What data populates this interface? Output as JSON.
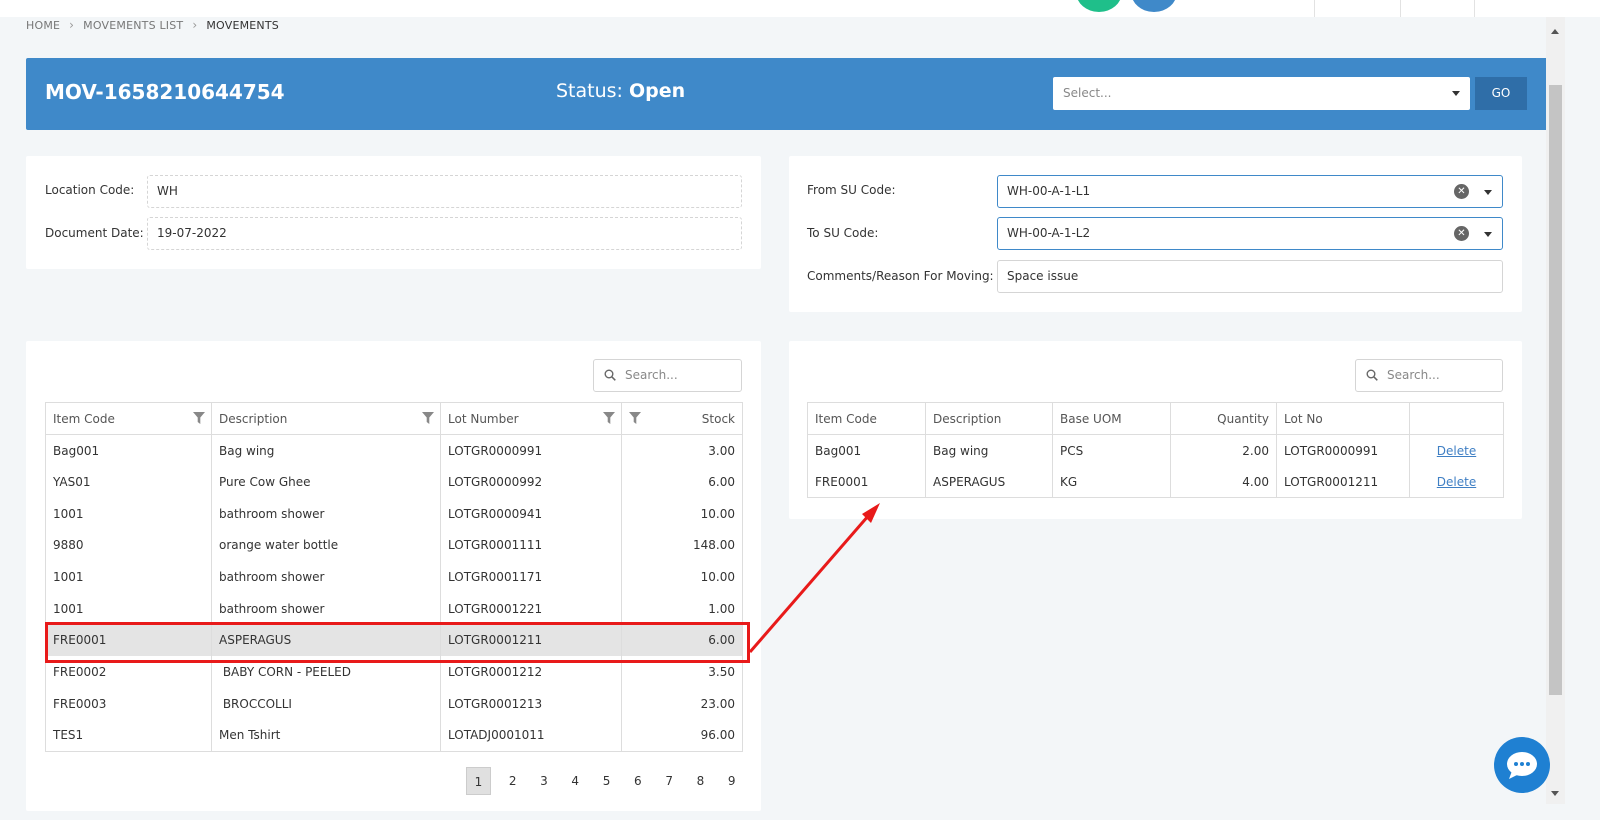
{
  "breadcrumb": {
    "items": [
      "HOME",
      "MOVEMENTS LIST",
      "MOVEMENTS"
    ]
  },
  "header": {
    "doc_no": "MOV-1658210644754",
    "status_label": "Status: ",
    "status_value": "Open",
    "select_placeholder": "Select...",
    "go_label": "GO"
  },
  "left_form": {
    "location_label": "Location Code:",
    "location_value": "WH",
    "date_label": "Document Date:",
    "date_value": "19-07-2022"
  },
  "right_form": {
    "from_label": "From SU Code:",
    "from_value": "WH-00-A-1-L1",
    "to_label": "To SU Code:",
    "to_value": "WH-00-A-1-L2",
    "comments_label": "Comments/Reason For Moving:",
    "comments_value": "Space issue"
  },
  "stock_table": {
    "search_placeholder": "Search...",
    "columns": [
      "Item Code",
      "Description",
      "Lot Number",
      "Stock"
    ],
    "rows": [
      [
        "Bag001",
        "Bag wing",
        "LOTGR0000991",
        "3.00"
      ],
      [
        "YAS01",
        "Pure Cow Ghee",
        "LOTGR0000992",
        "6.00"
      ],
      [
        "1001",
        "bathroom shower",
        "LOTGR0000941",
        "10.00"
      ],
      [
        "9880",
        "orange water bottle",
        "LOTGR0001111",
        "148.00"
      ],
      [
        "1001",
        "bathroom shower",
        "LOTGR0001171",
        "10.00"
      ],
      [
        "1001",
        "bathroom shower",
        "LOTGR0001221",
        "1.00"
      ],
      [
        "FRE0001",
        "ASPERAGUS",
        "LOTGR0001211",
        "6.00"
      ],
      [
        "FRE0002",
        " BABY CORN - PEELED",
        "LOTGR0001212",
        "3.50"
      ],
      [
        "FRE0003",
        " BROCCOLLI",
        "LOTGR0001213",
        "23.00"
      ],
      [
        "TES1",
        "Men Tshirt",
        "LOTADJ0001011",
        "96.00"
      ]
    ],
    "pages": [
      "1",
      "2",
      "3",
      "4",
      "5",
      "6",
      "7",
      "8",
      "9"
    ]
  },
  "move_table": {
    "search_placeholder": "Search...",
    "columns": [
      "Item Code",
      "Description",
      "Base UOM",
      "Quantity",
      "Lot No",
      ""
    ],
    "rows": [
      [
        "Bag001",
        "Bag wing",
        "PCS",
        "2.00",
        "LOTGR0000991",
        "Delete"
      ],
      [
        "FRE0001",
        "ASPERAGUS",
        "KG",
        "4.00",
        "LOTGR0001211",
        "Delete"
      ]
    ]
  },
  "colors": {
    "header_bg": "#3f89c9",
    "go_bg": "#2f6ea8",
    "annotation": "#e81a1a",
    "link": "#3f7fc4",
    "chat_bg": "#1f80d2"
  },
  "icons": [
    "filter-icon",
    "search-icon",
    "clear-icon",
    "chevron-down-icon",
    "chat-icon"
  ]
}
